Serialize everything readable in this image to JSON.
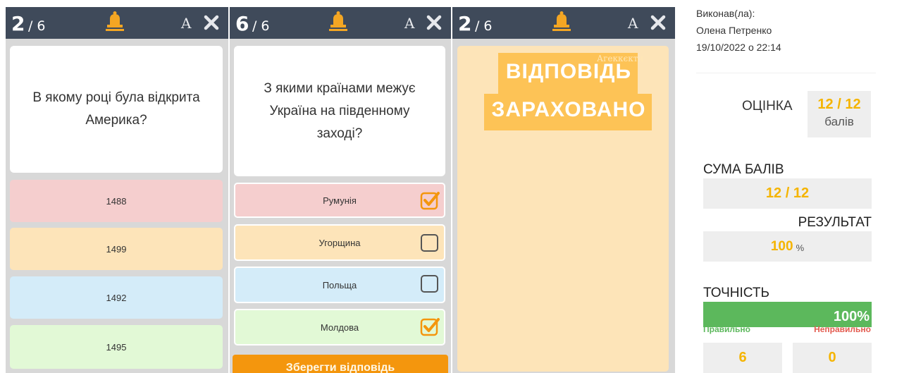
{
  "panel1": {
    "counter_current": "2",
    "counter_total": "/ 6",
    "font_label": "A",
    "question": "В якому році була відкрита Америка?",
    "answers": [
      "1488",
      "1499",
      "1492",
      "1495"
    ]
  },
  "panel2": {
    "counter_current": "6",
    "counter_total": "/ 6",
    "font_label": "A",
    "question": "З якими країнами межує Україна на південному заході?",
    "answers": [
      {
        "label": "Румунія",
        "checked": true
      },
      {
        "label": "Угорщина",
        "checked": false
      },
      {
        "label": "Польща",
        "checked": false
      },
      {
        "label": "Молдова",
        "checked": true
      }
    ],
    "save_label": "Зберегти відповідь"
  },
  "panel3": {
    "counter_current": "2",
    "counter_total": "/ 6",
    "font_label": "A",
    "stamp_line1": "ВІДПОВІДЬ",
    "stamp_line2": "ЗАРАХОВАНО",
    "watermark": "Агеккєкти"
  },
  "summary": {
    "done_by_label": "Виконав(ла):",
    "name": "Олена Петренко",
    "datetime": "19/10/2022 о 22:14",
    "grade_label": "ОЦІНКА",
    "grade_value": "12 / 12",
    "grade_unit": "балів",
    "sum_label": "СУМА БАЛІВ",
    "sum_value": "12 / 12",
    "result_label": "РЕЗУЛЬТАТ",
    "result_value": "100",
    "result_unit": "%",
    "accuracy_label": "ТОЧНІСТЬ",
    "accuracy_value": "100%",
    "accuracy_fraction": 1.0,
    "correct_label": "Правильно",
    "wrong_label": "Неправильно",
    "correct_count": "6",
    "wrong_count": "0"
  },
  "icons": {
    "bell": "bell-icon",
    "close": "close-icon",
    "font_size": "font-size-icon",
    "checked": "checkbox-checked-icon",
    "unchecked": "checkbox-unchecked-icon"
  },
  "colors": {
    "header": "#3f4a5a",
    "accent": "#f4960d",
    "correct": "#5cb85c",
    "wrong": "#e35b4f",
    "score": "#f5b400"
  }
}
